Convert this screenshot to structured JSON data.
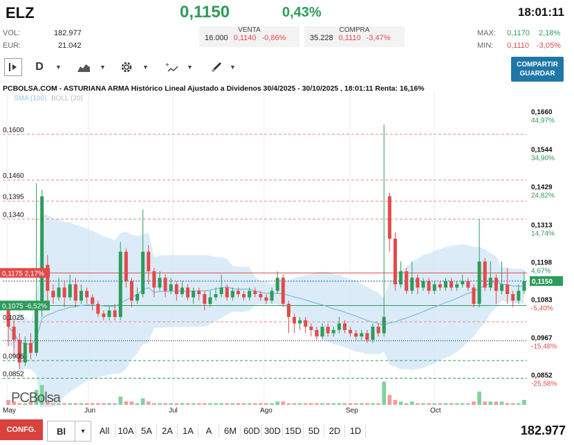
{
  "header": {
    "ticker": "ELZ",
    "price": "0,1150",
    "change_pct": "0,43%",
    "time": "18:01:11"
  },
  "stats": {
    "vol_label": "VOL:",
    "vol_value": "182.977",
    "eur_label": "EUR:",
    "eur_value": "21.042",
    "max_label": "MAX:",
    "max_value": "0,1170",
    "max_pct": "2,18%",
    "min_label": "MIN:",
    "min_value": "0,1110",
    "min_pct": "-3,05%"
  },
  "market": {
    "venta_label": "VENTA",
    "venta_qty": "16.000",
    "venta_price": "0,1140",
    "venta_pct": "-0,86%",
    "compra_label": "COMPRA",
    "compra_qty": "35.228",
    "compra_price": "0,1110",
    "compra_pct": "-3,47%"
  },
  "toolbar": {
    "period": "D",
    "share_line1": "COMPARTIR",
    "share_line2": "GUARDAR"
  },
  "chart_title": "PCBOLSA.COM - ASTURIANA ARMA Histórico Lineal Ajustado a Dividenos 30/4/2025 - 30/10/2025 , 18:01:11 Renta: 16,16%",
  "indicators": {
    "sma": "SMA (100)",
    "boll": "BOLL (20)"
  },
  "watermark": "PCBolsa",
  "left_levels": [
    {
      "price": "0,1600",
      "label": "0,1600"
    },
    {
      "price": "0,1460",
      "label": "0,1460"
    },
    {
      "price": "0,1395",
      "label": "0,1395"
    },
    {
      "price": "0,1340",
      "label": "0,1340"
    },
    {
      "price": "0,1175",
      "label": "0,1175  2,17%"
    },
    {
      "price": "0,1075",
      "label": "0,1075  -6,52%"
    },
    {
      "price": "0,1025",
      "label": "0,1025"
    },
    {
      "price": "0,0906",
      "label": "0,0906"
    },
    {
      "price": "0,0852",
      "label": "0,0852"
    }
  ],
  "right_axis": [
    {
      "price": "0,1660",
      "pct": "44,97%"
    },
    {
      "price": "0,1544",
      "pct": "34,90%"
    },
    {
      "price": "0,1429",
      "pct": "24,82%"
    },
    {
      "price": "0,1313",
      "pct": "14,74%"
    },
    {
      "price": "0,1198",
      "pct": "4,67%"
    },
    {
      "price": "0,1150",
      "pct": ""
    },
    {
      "price": "0,1083",
      "pct": "-5,40%"
    },
    {
      "price": "0,0967",
      "pct": "-15,48%"
    },
    {
      "price": "0,0852",
      "pct": "-25,58%"
    }
  ],
  "x_months": [
    "May",
    "Jun",
    "Jul",
    "Ago",
    "Sep",
    "Oct"
  ],
  "bottom": {
    "config": "CONFG.",
    "mode": "Bl",
    "ranges": [
      "All",
      "10A",
      "5A",
      "2A",
      "1A",
      "A",
      "6M",
      "60D",
      "30D",
      "15D",
      "5D",
      "2D",
      "1D"
    ],
    "total_volume": "182.977"
  },
  "colors": {
    "up": "#2e9b5a",
    "down": "#e24a4a",
    "band": "#cfe6f6",
    "accent": "#1f77a8"
  },
  "chart_data": {
    "type": "candlestick",
    "title": "PCBOLSA.COM - ASTURIANA ARMA Histórico Lineal Ajustado a Dividenos 30/4/2025 - 30/10/2025 , 18:01:11 Renta: 16,16%",
    "ylim": [
      0.08,
      0.17
    ],
    "last": 0.115,
    "candles": [
      [
        0.106,
        0.101,
        0.108,
        0.095
      ],
      [
        0.101,
        0.097,
        0.103,
        0.092
      ],
      [
        0.097,
        0.09,
        0.099,
        0.088
      ],
      [
        0.09,
        0.096,
        0.098,
        0.089
      ],
      [
        0.096,
        0.093,
        0.099,
        0.091
      ],
      [
        0.093,
        0.107,
        0.145,
        0.092
      ],
      [
        0.107,
        0.141,
        0.143,
        0.104
      ],
      [
        0.12,
        0.112,
        0.123,
        0.108
      ],
      [
        0.112,
        0.11,
        0.114,
        0.108
      ],
      [
        0.11,
        0.113,
        0.116,
        0.109
      ],
      [
        0.113,
        0.11,
        0.115,
        0.107
      ],
      [
        0.11,
        0.114,
        0.117,
        0.109
      ],
      [
        0.114,
        0.109,
        0.116,
        0.107
      ],
      [
        0.109,
        0.112,
        0.114,
        0.108
      ],
      [
        0.112,
        0.11,
        0.113,
        0.108
      ],
      [
        0.11,
        0.108,
        0.111,
        0.106
      ],
      [
        0.108,
        0.105,
        0.109,
        0.104
      ],
      [
        0.105,
        0.104,
        0.106,
        0.103
      ],
      [
        0.104,
        0.106,
        0.107,
        0.103
      ],
      [
        0.106,
        0.104,
        0.108,
        0.103
      ],
      [
        0.104,
        0.124,
        0.127,
        0.103
      ],
      [
        0.124,
        0.115,
        0.125,
        0.113
      ],
      [
        0.115,
        0.109,
        0.116,
        0.107
      ],
      [
        0.109,
        0.111,
        0.113,
        0.108
      ],
      [
        0.111,
        0.124,
        0.137,
        0.11
      ],
      [
        0.124,
        0.118,
        0.126,
        0.114
      ],
      [
        0.118,
        0.113,
        0.119,
        0.11
      ],
      [
        0.113,
        0.116,
        0.118,
        0.112
      ],
      [
        0.116,
        0.112,
        0.117,
        0.11
      ],
      [
        0.112,
        0.114,
        0.116,
        0.111
      ],
      [
        0.114,
        0.111,
        0.115,
        0.109
      ],
      [
        0.111,
        0.113,
        0.115,
        0.11
      ],
      [
        0.113,
        0.11,
        0.114,
        0.109
      ],
      [
        0.11,
        0.112,
        0.113,
        0.108
      ],
      [
        0.112,
        0.111,
        0.113,
        0.109
      ],
      [
        0.111,
        0.108,
        0.112,
        0.106
      ],
      [
        0.108,
        0.11,
        0.112,
        0.107
      ],
      [
        0.11,
        0.111,
        0.113,
        0.109
      ],
      [
        0.111,
        0.113,
        0.117,
        0.11
      ],
      [
        0.113,
        0.11,
        0.114,
        0.109
      ],
      [
        0.11,
        0.112,
        0.113,
        0.109
      ],
      [
        0.112,
        0.111,
        0.113,
        0.11
      ],
      [
        0.111,
        0.11,
        0.112,
        0.109
      ],
      [
        0.11,
        0.112,
        0.113,
        0.109
      ],
      [
        0.112,
        0.111,
        0.113,
        0.11
      ],
      [
        0.111,
        0.11,
        0.112,
        0.109
      ],
      [
        0.11,
        0.109,
        0.111,
        0.108
      ],
      [
        0.109,
        0.112,
        0.113,
        0.108
      ],
      [
        0.112,
        0.116,
        0.118,
        0.111
      ],
      [
        0.116,
        0.108,
        0.117,
        0.107
      ],
      [
        0.108,
        0.104,
        0.109,
        0.099
      ],
      [
        0.104,
        0.102,
        0.105,
        0.099
      ],
      [
        0.102,
        0.103,
        0.104,
        0.1
      ],
      [
        0.103,
        0.101,
        0.104,
        0.099
      ],
      [
        0.101,
        0.1,
        0.102,
        0.098
      ],
      [
        0.1,
        0.098,
        0.101,
        0.097
      ],
      [
        0.098,
        0.101,
        0.102,
        0.097
      ],
      [
        0.101,
        0.099,
        0.102,
        0.098
      ],
      [
        0.099,
        0.1,
        0.101,
        0.098
      ],
      [
        0.1,
        0.102,
        0.104,
        0.099
      ],
      [
        0.102,
        0.1,
        0.103,
        0.099
      ],
      [
        0.1,
        0.099,
        0.101,
        0.098
      ],
      [
        0.099,
        0.098,
        0.1,
        0.097
      ],
      [
        0.098,
        0.099,
        0.1,
        0.097
      ],
      [
        0.099,
        0.097,
        0.1,
        0.096
      ],
      [
        0.097,
        0.101,
        0.102,
        0.096
      ],
      [
        0.101,
        0.099,
        0.102,
        0.098
      ],
      [
        0.099,
        0.104,
        0.163,
        0.098
      ],
      [
        0.141,
        0.128,
        0.142,
        0.124
      ],
      [
        0.128,
        0.114,
        0.13,
        0.112
      ],
      [
        0.114,
        0.118,
        0.121,
        0.113
      ],
      [
        0.118,
        0.112,
        0.119,
        0.111
      ],
      [
        0.112,
        0.116,
        0.121,
        0.111
      ],
      [
        0.116,
        0.113,
        0.117,
        0.111
      ],
      [
        0.113,
        0.115,
        0.116,
        0.112
      ],
      [
        0.115,
        0.112,
        0.116,
        0.111
      ],
      [
        0.112,
        0.114,
        0.115,
        0.111
      ],
      [
        0.114,
        0.113,
        0.115,
        0.112
      ],
      [
        0.113,
        0.115,
        0.116,
        0.112
      ],
      [
        0.115,
        0.113,
        0.116,
        0.112
      ],
      [
        0.113,
        0.114,
        0.115,
        0.112
      ],
      [
        0.114,
        0.115,
        0.117,
        0.113
      ],
      [
        0.115,
        0.113,
        0.116,
        0.112
      ],
      [
        0.113,
        0.108,
        0.114,
        0.107
      ],
      [
        0.108,
        0.121,
        0.134,
        0.107
      ],
      [
        0.121,
        0.113,
        0.122,
        0.112
      ],
      [
        0.113,
        0.116,
        0.121,
        0.112
      ],
      [
        0.116,
        0.112,
        0.117,
        0.108
      ],
      [
        0.112,
        0.114,
        0.121,
        0.111
      ],
      [
        0.114,
        0.111,
        0.119,
        0.108
      ],
      [
        0.111,
        0.109,
        0.112,
        0.107
      ],
      [
        0.109,
        0.112,
        0.114,
        0.108
      ],
      [
        0.112,
        0.115,
        0.118,
        0.111
      ]
    ],
    "volumes": [
      3,
      2,
      1,
      1,
      2,
      9,
      12,
      2,
      1,
      1,
      1,
      1,
      1,
      1,
      1,
      1,
      1,
      1,
      1,
      1,
      5,
      2,
      2,
      1,
      4,
      2,
      1,
      1,
      1,
      1,
      1,
      1,
      1,
      1,
      1,
      1,
      1,
      1,
      1,
      1,
      1,
      1,
      1,
      1,
      1,
      1,
      1,
      1,
      2,
      2,
      1,
      1,
      1,
      1,
      1,
      1,
      1,
      1,
      1,
      1,
      1,
      1,
      1,
      1,
      1,
      1,
      1,
      14,
      6,
      3,
      2,
      1,
      2,
      1,
      1,
      1,
      1,
      1,
      1,
      1,
      1,
      1,
      1,
      2,
      8,
      2,
      2,
      2,
      2,
      1,
      1,
      1,
      3
    ]
  }
}
